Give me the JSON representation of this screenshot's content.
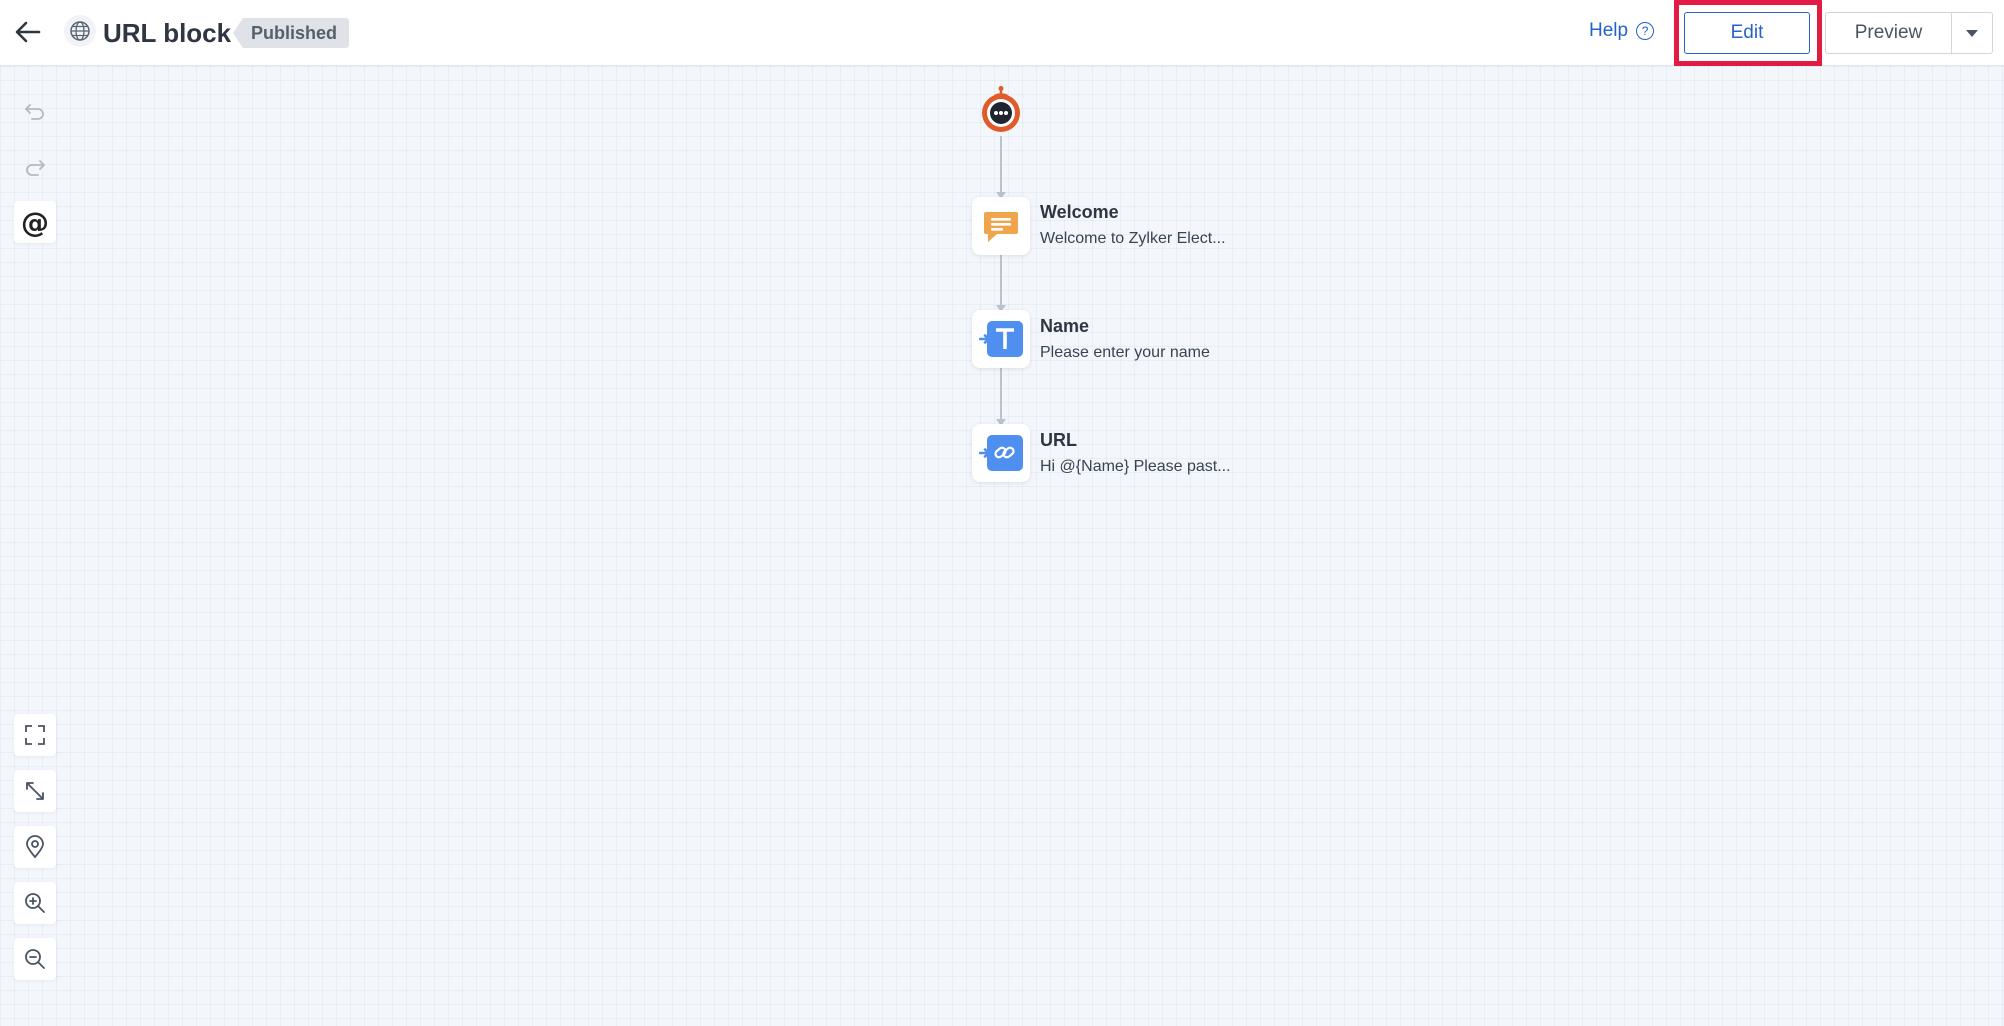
{
  "header": {
    "title": "URL block",
    "status_badge": "Published",
    "help_label": "Help",
    "edit_label": "Edit",
    "preview_label": "Preview"
  },
  "colors": {
    "accent": "#2563c9",
    "highlight": "#e21b45",
    "bot": "#e05a2b",
    "message_node": "#f0a44b",
    "input_node": "#4f8ff0"
  },
  "toolbar": {
    "top": [
      "undo-icon",
      "redo-icon",
      "mention-icon"
    ],
    "bottom": [
      "fullscreen-icon",
      "fit-view-icon",
      "locate-icon",
      "zoom-in-icon",
      "zoom-out-icon"
    ]
  },
  "flow": {
    "start_icon": "bot-icon",
    "nodes": [
      {
        "label": "Welcome",
        "text": "Welcome to Zylker Elect...",
        "icon": "message-icon"
      },
      {
        "label": "Name",
        "text": "Please enter your name",
        "icon": "text-input-icon"
      },
      {
        "label": "URL",
        "text": "Hi  @{Name}  Please past...",
        "icon": "link-icon"
      }
    ]
  }
}
